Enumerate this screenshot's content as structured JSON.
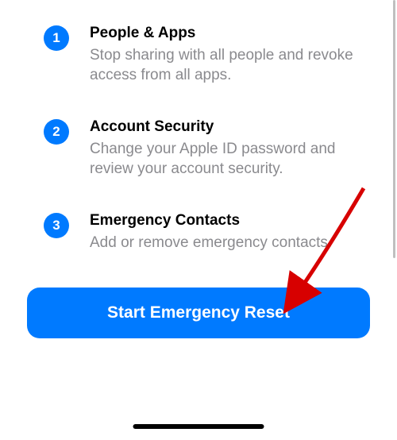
{
  "steps": [
    {
      "number": "1",
      "title": "People & Apps",
      "desc": "Stop sharing with all people and revoke access from all apps."
    },
    {
      "number": "2",
      "title": "Account Security",
      "desc": "Change your Apple ID password and review your account security."
    },
    {
      "number": "3",
      "title": "Emergency Contacts",
      "desc": "Add or remove emergency contacts."
    }
  ],
  "cta_label": "Start Emergency Reset",
  "colors": {
    "accent": "#007aff",
    "secondary_text": "#8a8a8e"
  }
}
